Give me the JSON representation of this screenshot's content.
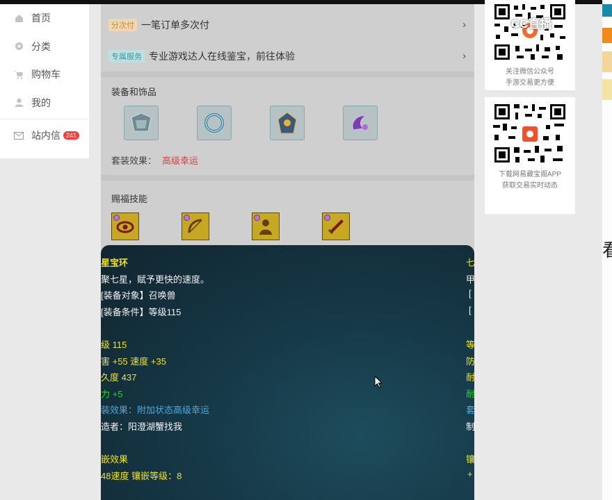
{
  "nav": {
    "items": [
      {
        "label": "首页"
      },
      {
        "label": "分类"
      },
      {
        "label": "购物车"
      },
      {
        "label": "我的"
      }
    ],
    "messages": {
      "label": "站内信",
      "badge": "241"
    }
  },
  "rows": {
    "installment": {
      "tag": "分次付",
      "text": "一笔订单多次付"
    },
    "service": {
      "tag": "专属服务",
      "text": "专业游戏达人在线鉴宝，前往体验"
    }
  },
  "equipment": {
    "title": "装备和饰品",
    "set_label": "套装效果：",
    "set_value": "高级幸运"
  },
  "skills": {
    "title": "赐福技能"
  },
  "tooltip": {
    "left": {
      "name": "星宝环",
      "desc": "聚七星，赋予更快的速度。",
      "target": "[装备对象】召唤兽",
      "cond": "[装备条件】等级115",
      "level": "级 115",
      "stats": "害 +55 速度 +35",
      "durability": "久度 437",
      "power": "力 +5",
      "set_effect": "装效果：附加状态高级幸运",
      "maker": "造者：阳澄湖蟹找我",
      "inlay_title": "嵌效果",
      "inlay": "48速度 镶嵌等级：8"
    },
    "right": {
      "c1": "七",
      "c2": "甲",
      "c3": "[",
      "c4": "[",
      "c5": "等",
      "c6": "防",
      "c7": "耐",
      "c8": "耐",
      "c9": "套",
      "c10": "制",
      "c11": "镶",
      "c12": "+"
    }
  },
  "sidebar_right": {
    "wechat": {
      "line1": "关注微信公众号",
      "line2": "手游交易更方便"
    },
    "app": {
      "line1": "下载网易藏宝阁APP",
      "line2": "获取交易实时动态"
    },
    "edge_glyph": "看",
    "watermark": "CC直播"
  },
  "colors": {
    "tooltip_bg": "#163847",
    "title_yellow": "#f2e321",
    "stat_green": "#28d12a",
    "set_blue": "#4fa8d9",
    "set_red": "#d14444"
  }
}
